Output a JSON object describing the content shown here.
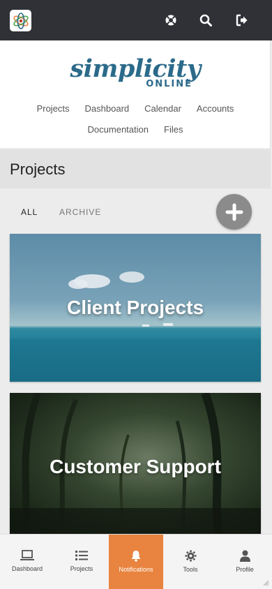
{
  "brand": {
    "main": "simplicity",
    "sub": "ONLINE"
  },
  "nav": {
    "row1": [
      "Projects",
      "Dashboard",
      "Calendar",
      "Accounts"
    ],
    "row2": [
      "Documentation",
      "Files"
    ]
  },
  "page_title": "Projects",
  "filters": {
    "all": "ALL",
    "archive": "ARCHIVE"
  },
  "cards": [
    {
      "title": "Client Projects"
    },
    {
      "title": "Customer Support"
    }
  ],
  "tabbar": [
    {
      "label": "Dashboard",
      "icon": "laptop-icon"
    },
    {
      "label": "Projects",
      "icon": "list-icon"
    },
    {
      "label": "Notifications",
      "icon": "bell-icon",
      "active": true
    },
    {
      "label": "Tools",
      "icon": "gear-icon"
    },
    {
      "label": "Profile",
      "icon": "person-icon"
    }
  ],
  "colors": {
    "topbar": "#2f3136",
    "brand": "#2b6a8a",
    "accent": "#e8843f"
  }
}
